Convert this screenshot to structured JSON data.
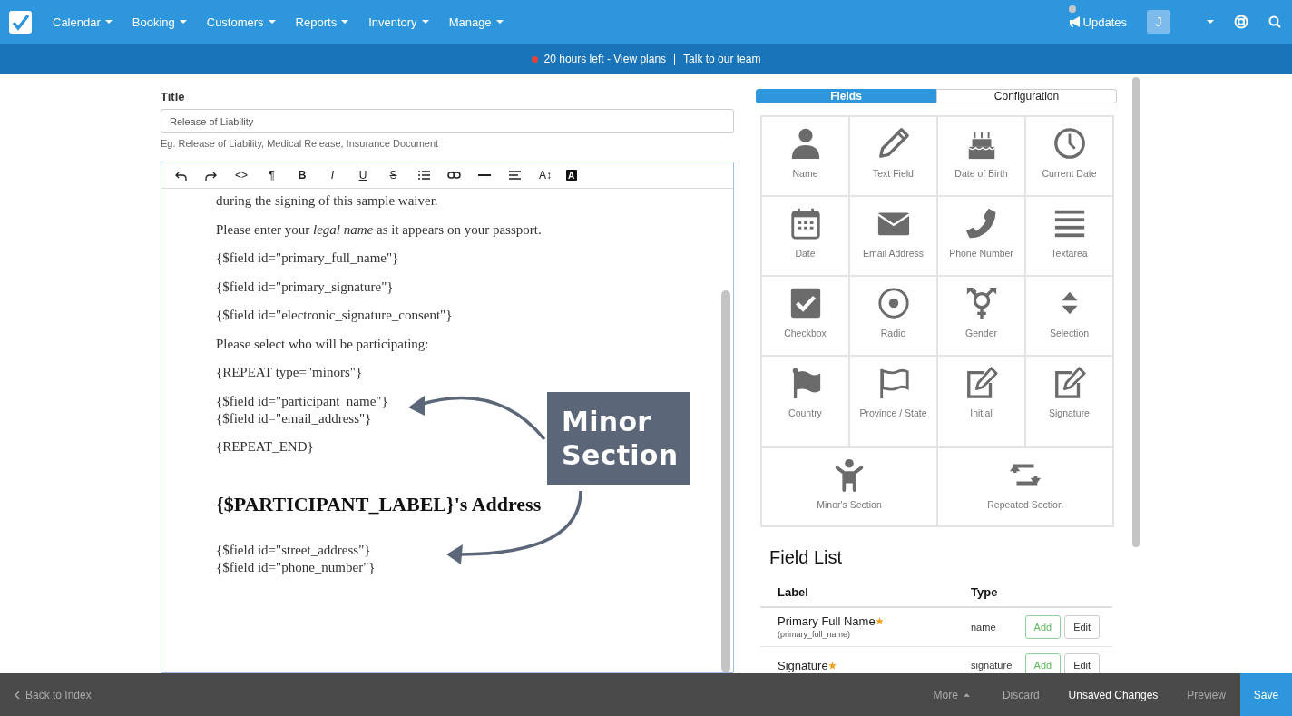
{
  "nav": {
    "menus": [
      {
        "label": "Calendar"
      },
      {
        "label": "Booking"
      },
      {
        "label": "Customers"
      },
      {
        "label": "Reports"
      },
      {
        "label": "Inventory"
      },
      {
        "label": "Manage"
      }
    ],
    "updates": "Updates",
    "avatar": "J"
  },
  "banner": {
    "trial": "20 hours left - View plans",
    "talk": "Talk to our team"
  },
  "form": {
    "title_label": "Title",
    "title_value": "Release of Liability",
    "hint": "Eg. Release of Liability, Medical Release, Insurance Document",
    "toolbar": [
      {
        "kind": "undo"
      },
      {
        "kind": "redo"
      },
      {
        "kind": "code",
        "text": "<>"
      },
      {
        "kind": "paragraph",
        "text": "¶"
      },
      {
        "kind": "bold",
        "text": "B"
      },
      {
        "kind": "italic",
        "text": "I"
      },
      {
        "kind": "underline",
        "text": "U"
      },
      {
        "kind": "strike",
        "text": "S"
      },
      {
        "kind": "list"
      },
      {
        "kind": "link"
      },
      {
        "kind": "rule"
      },
      {
        "kind": "align"
      },
      {
        "kind": "size",
        "text": "A↕"
      },
      {
        "kind": "highlight",
        "text": "A"
      }
    ],
    "content": [
      {
        "kind": "paragraph",
        "lines": [
          "during the signing of this sample waiver."
        ]
      },
      {
        "kind": "paragraph",
        "lines": [
          "Please enter your *legal name* as it appears on your passport."
        ]
      },
      {
        "kind": "paragraph",
        "lines": [
          "{$field id=\"primary_full_name\"}"
        ]
      },
      {
        "kind": "paragraph",
        "lines": [
          "{$field id=\"primary_signature\"}"
        ]
      },
      {
        "kind": "paragraph",
        "lines": [
          "{$field id=\"electronic_signature_consent\"}"
        ]
      },
      {
        "kind": "paragraph",
        "lines": [
          "Please select who will be participating:"
        ]
      },
      {
        "kind": "paragraph",
        "lines": [
          "{REPEAT type=\"minors\"}"
        ]
      },
      {
        "kind": "paragraph",
        "lines": [
          "{$field id=\"participant_name\"}",
          "{$field id=\"email_address\"}"
        ]
      },
      {
        "kind": "paragraph",
        "lines": [
          "{REPEAT_END}"
        ]
      },
      {
        "kind": "heading",
        "lines": [
          "{$PARTICIPANT_LABEL}'s Address"
        ]
      },
      {
        "kind": "paragraph",
        "lines": [
          "{$field id=\"street_address\"}",
          "{$field id=\"phone_number\"}"
        ]
      }
    ],
    "callout": "Minor Section"
  },
  "tabs": [
    {
      "label": "Fields",
      "selected": true
    },
    {
      "label": "Configuration",
      "selected": false
    }
  ],
  "fields": [
    {
      "label": "Name",
      "kind": "person"
    },
    {
      "label": "Text Field",
      "kind": "pencil"
    },
    {
      "label": "Date of Birth",
      "kind": "cake"
    },
    {
      "label": "Current Date",
      "kind": "clock"
    },
    {
      "label": "Date",
      "kind": "calendar"
    },
    {
      "label": "Email Address",
      "kind": "envelope"
    },
    {
      "label": "Phone Number",
      "kind": "phone"
    },
    {
      "label": "Textarea",
      "kind": "lines"
    },
    {
      "label": "Checkbox",
      "kind": "checkbox"
    },
    {
      "label": "Radio",
      "kind": "radio"
    },
    {
      "label": "Gender",
      "kind": "gender"
    },
    {
      "label": "Selection",
      "kind": "updown"
    },
    {
      "label": "Country",
      "kind": "flag"
    },
    {
      "label": "Province / State",
      "kind": "flag-outline"
    },
    {
      "label": "Initial",
      "kind": "edit"
    },
    {
      "label": "Signature",
      "kind": "edit"
    },
    {
      "label": "Minor's Section",
      "kind": "child"
    },
    {
      "label": "Repeated Section",
      "kind": "repeat"
    }
  ],
  "field_list": {
    "title": "Field List",
    "columns": [
      "Label",
      "Type"
    ],
    "rows": [
      {
        "label": "Primary Full Name",
        "required": true,
        "key": "(primary_full_name)",
        "type": "name",
        "add": "Add",
        "edit": "Edit"
      },
      {
        "label": "Signature",
        "required": true,
        "type": "signature",
        "add": "Add",
        "edit": "Edit"
      }
    ]
  },
  "bottom": {
    "back": "Back to Index",
    "more": "More",
    "discard": "Discard",
    "status": "Unsaved Changes",
    "preview": "Preview",
    "save": "Save"
  }
}
